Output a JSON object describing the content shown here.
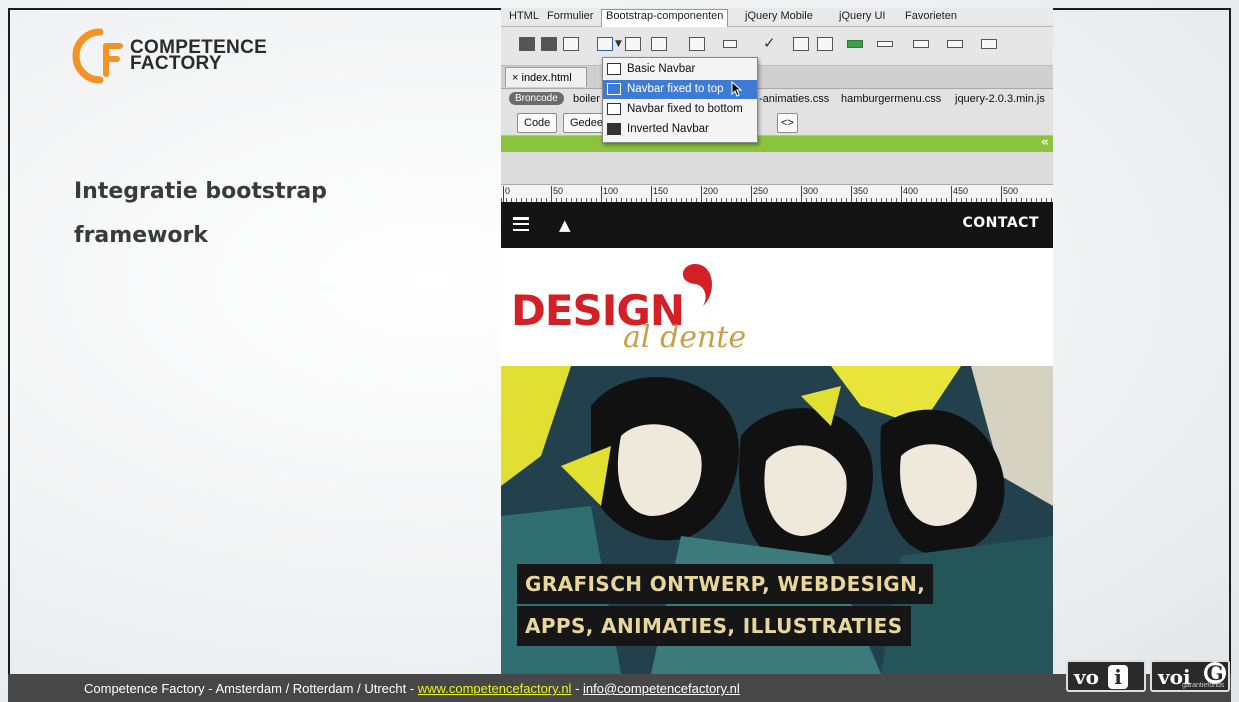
{
  "slide": {
    "logo_line1": "COMPETENCE",
    "logo_line2": "FACTORY",
    "title": "Integratie bootstrap framework"
  },
  "app": {
    "tabs": [
      "HTML",
      "Formulier",
      "Bootstrap-componenten",
      "jQuery Mobile",
      "jQuery UI",
      "Favorieten"
    ],
    "active_tab": "Bootstrap-componenten",
    "doc_tab": "index.html",
    "close_glyph": "×",
    "source_pill": "Broncode",
    "related_files": [
      "boiler",
      "-animaties.css",
      "hamburgermenu.css",
      "jquery-2.0.3.min.js"
    ],
    "view_buttons": [
      "Code",
      "Gedee"
    ],
    "green_arrows": "«",
    "ruler_ticks": [
      "0",
      "50",
      "100",
      "150",
      "200",
      "250",
      "300",
      "350",
      "400",
      "450",
      "500"
    ]
  },
  "menu": {
    "items": [
      {
        "label": "Basic Navbar",
        "selected": false
      },
      {
        "label": "Navbar fixed to top",
        "selected": true
      },
      {
        "label": "Navbar fixed to bottom",
        "selected": false
      },
      {
        "label": "Inverted Navbar",
        "selected": false
      }
    ]
  },
  "site": {
    "nav_contact": "CONTACT",
    "brand_design": "DESIGN",
    "brand_sub": "al dente",
    "tagline1": "GRAFISCH ONTWERP, WEBDESIGN,",
    "tagline2": "APPS, ANIMATIES, ILLUSTRATIES"
  },
  "footer": {
    "text": "Competence Factory -  Amsterdam / Rotterdam / Utrecht - ",
    "website": "www.competencefactory.nl",
    "separator": " - ",
    "email": "info@competencefactory.nl",
    "badge1": "vo",
    "badge1_mark": "i",
    "badge2": "voi",
    "badge2_mark": "G",
    "badge2_sub": "garantiefonds"
  },
  "colors": {
    "accent_orange": "#f39324",
    "menu_highlight": "#3d7bd6",
    "green_bar": "#8ac43f",
    "brand_red": "#d32027",
    "brand_gold": "#c9a04a",
    "footer_link": "#e8f51a"
  }
}
